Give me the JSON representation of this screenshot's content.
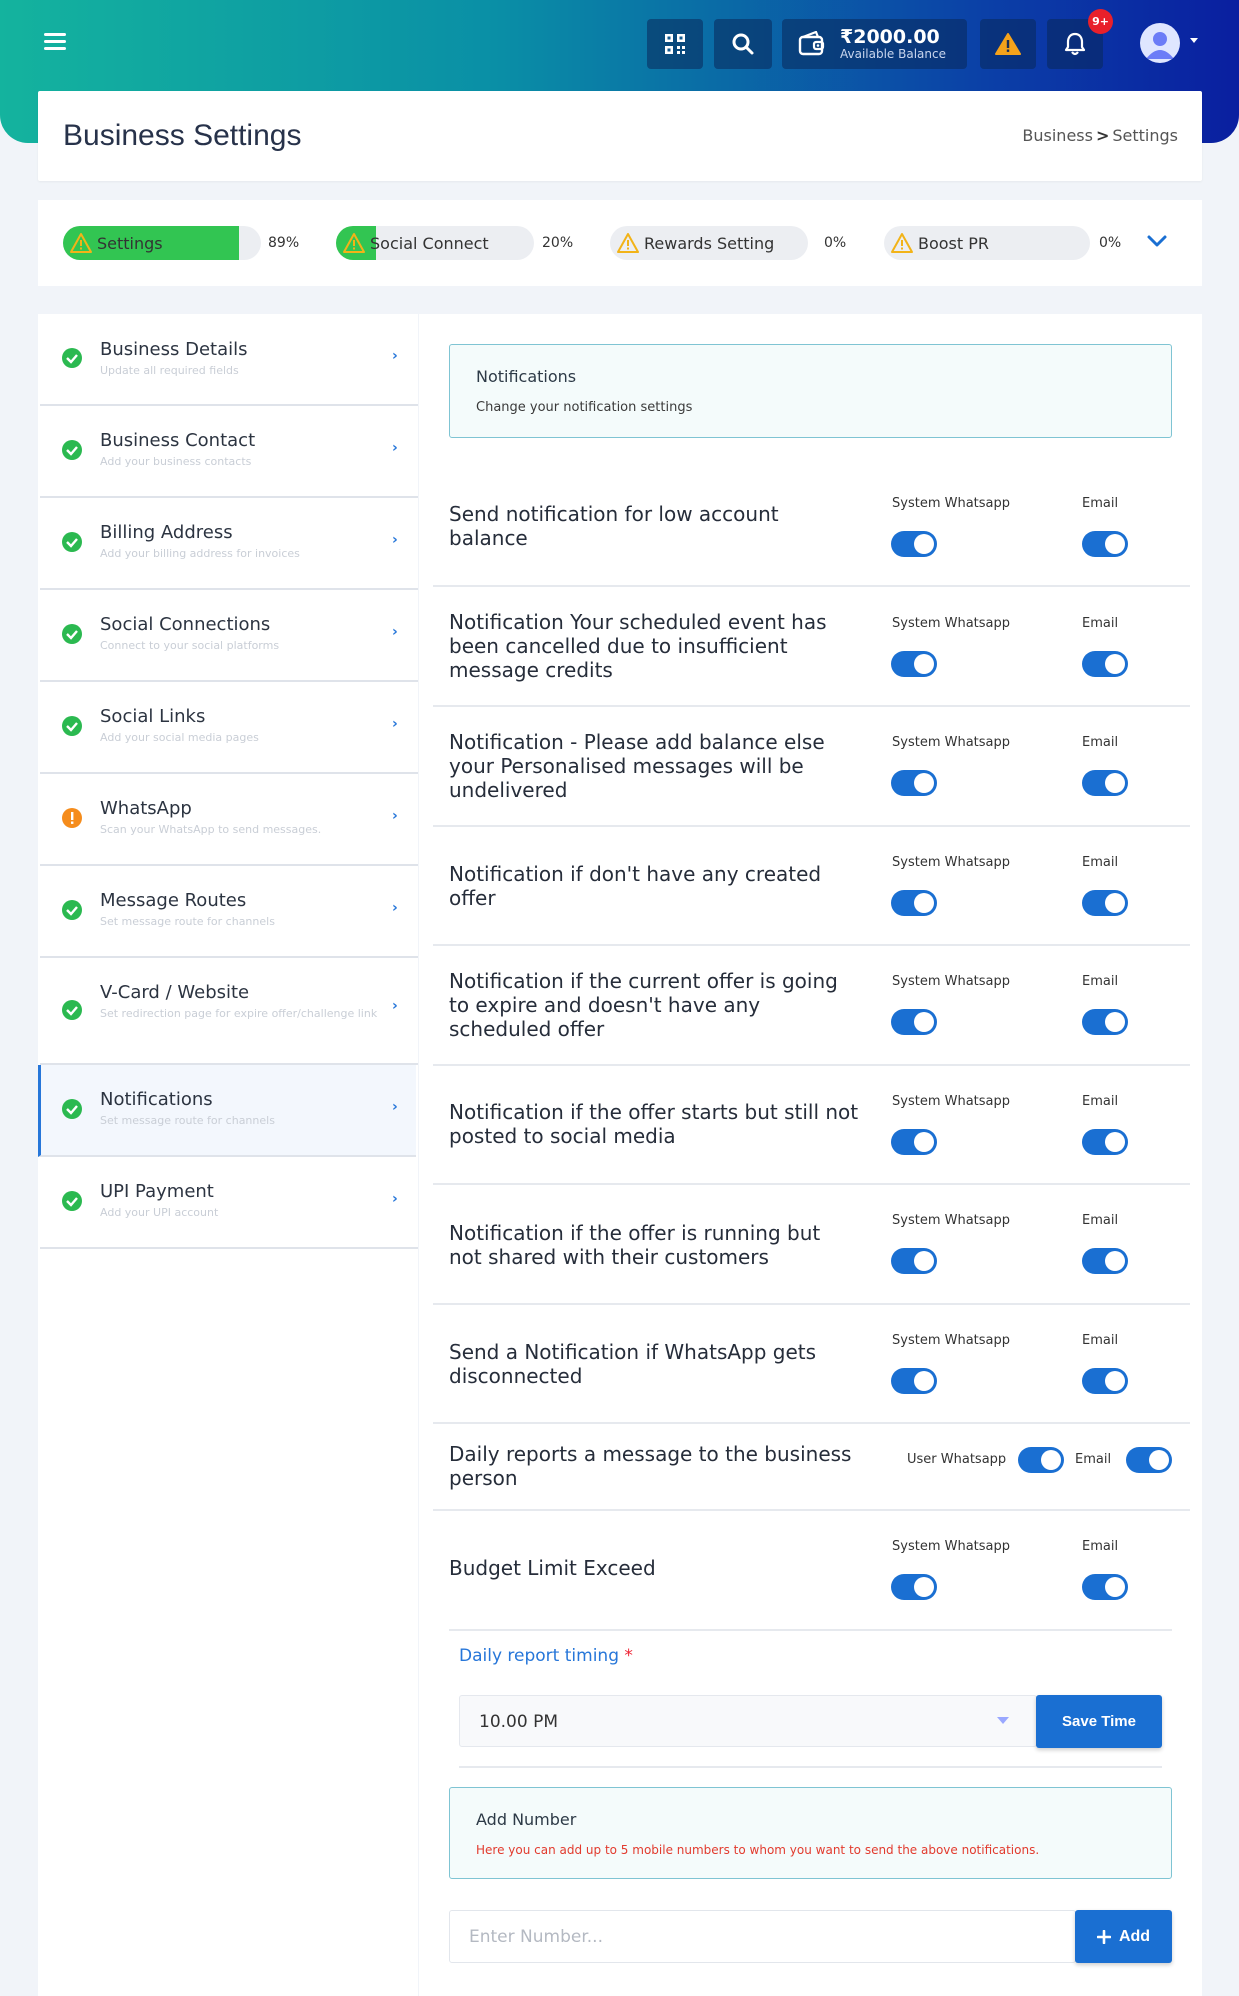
{
  "header": {
    "balance_amount": "₹2000.00",
    "balance_label": "Available Balance",
    "notification_badge": "9+"
  },
  "page": {
    "title": "Business Settings",
    "breadcrumb_parent": "Business",
    "breadcrumb_separator": ">",
    "breadcrumb_current": "Settings"
  },
  "progress": [
    {
      "label": "Settings",
      "percent_text": "89%",
      "value": 0.89
    },
    {
      "label": "Social Connect",
      "percent_text": "20%",
      "value": 0.2
    },
    {
      "label": "Rewards Setting",
      "percent_text": "0%",
      "value": 0
    },
    {
      "label": "Boost PR",
      "percent_text": "0%",
      "value": 0
    }
  ],
  "sidebar": {
    "items": [
      {
        "title": "Business Details",
        "subtitle": "Update all required fields",
        "status": "complete"
      },
      {
        "title": "Business Contact",
        "subtitle": "Add your business contacts",
        "status": "complete"
      },
      {
        "title": "Billing Address",
        "subtitle": "Add your billing address for invoices",
        "status": "complete"
      },
      {
        "title": "Social Connections",
        "subtitle": "Connect to your social platforms",
        "status": "complete"
      },
      {
        "title": "Social Links",
        "subtitle": "Add your social media pages",
        "status": "complete"
      },
      {
        "title": "WhatsApp",
        "subtitle": "Scan your WhatsApp to send messages.",
        "status": "warning"
      },
      {
        "title": "Message Routes",
        "subtitle": "Set message route for channels",
        "status": "complete"
      },
      {
        "title": "V-Card / Website",
        "subtitle": "Set redirection page for expire offer/challenge link",
        "status": "complete"
      },
      {
        "title": "Notifications",
        "subtitle": "Set message route for channels",
        "status": "complete",
        "active": true
      },
      {
        "title": "UPI Payment",
        "subtitle": "Add your UPI account",
        "status": "complete"
      }
    ]
  },
  "notifications_header": {
    "title": "Notifications",
    "subtitle": "Change your notification settings"
  },
  "notification_rows": [
    {
      "text": "Send notification for low account balance",
      "ch1": "System Whatsapp",
      "ch2": "Email",
      "ch1_on": true,
      "ch2_on": true
    },
    {
      "text": "Notification Your scheduled event has been cancelled due to insufficient message credits",
      "ch1": "System Whatsapp",
      "ch2": "Email",
      "ch1_on": true,
      "ch2_on": true
    },
    {
      "text": "Notification - Please add balance else your Personalised messages will be undelivered",
      "ch1": "System Whatsapp",
      "ch2": "Email",
      "ch1_on": true,
      "ch2_on": true
    },
    {
      "text": "Notification if don't have any created offer",
      "ch1": "System Whatsapp",
      "ch2": "Email",
      "ch1_on": true,
      "ch2_on": true
    },
    {
      "text": "Notification if the current offer is going to expire and doesn't have any scheduled offer",
      "ch1": "System Whatsapp",
      "ch2": "Email",
      "ch1_on": true,
      "ch2_on": true
    },
    {
      "text": "Notification if the offer starts but still not posted to social media",
      "ch1": "System Whatsapp",
      "ch2": "Email",
      "ch1_on": true,
      "ch2_on": true
    },
    {
      "text": "Notification if the offer is running but not shared with their customers",
      "ch1": "System Whatsapp",
      "ch2": "Email",
      "ch1_on": true,
      "ch2_on": true
    },
    {
      "text": "Send a Notification if WhatsApp gets disconnected",
      "ch1": "System Whatsapp",
      "ch2": "Email",
      "ch1_on": true,
      "ch2_on": true
    },
    {
      "text": "Daily reports a message to the business person",
      "ch1": "User Whatsapp",
      "ch2": "Email",
      "ch1_on": true,
      "ch2_on": true
    },
    {
      "text": "Budget Limit Exceed",
      "ch1": "System Whatsapp",
      "ch2": "Email",
      "ch1_on": true,
      "ch2_on": true
    }
  ],
  "daily_report": {
    "label": "Daily report timing",
    "required_mark": "*",
    "selected_time": "10.00 PM",
    "save_label": "Save Time"
  },
  "add_number": {
    "title": "Add Number",
    "note": "Here you can add up to 5 mobile numbers to whom you want to send the above notifications.",
    "placeholder": "Enter Number...",
    "button_label": "Add"
  },
  "colors": {
    "primary": "#1a6fd2",
    "success": "#2bb950",
    "warning": "#f58c1c",
    "progress_fill": "#32c552"
  },
  "icons": [
    "menu-icon",
    "qr-icon",
    "search-icon",
    "wallet-icon",
    "warning-icon",
    "bell-icon",
    "user-avatar",
    "chevron-down-icon",
    "check-circle-icon",
    "exclamation-circle-icon",
    "chevron-right-icon",
    "plus-icon"
  ]
}
